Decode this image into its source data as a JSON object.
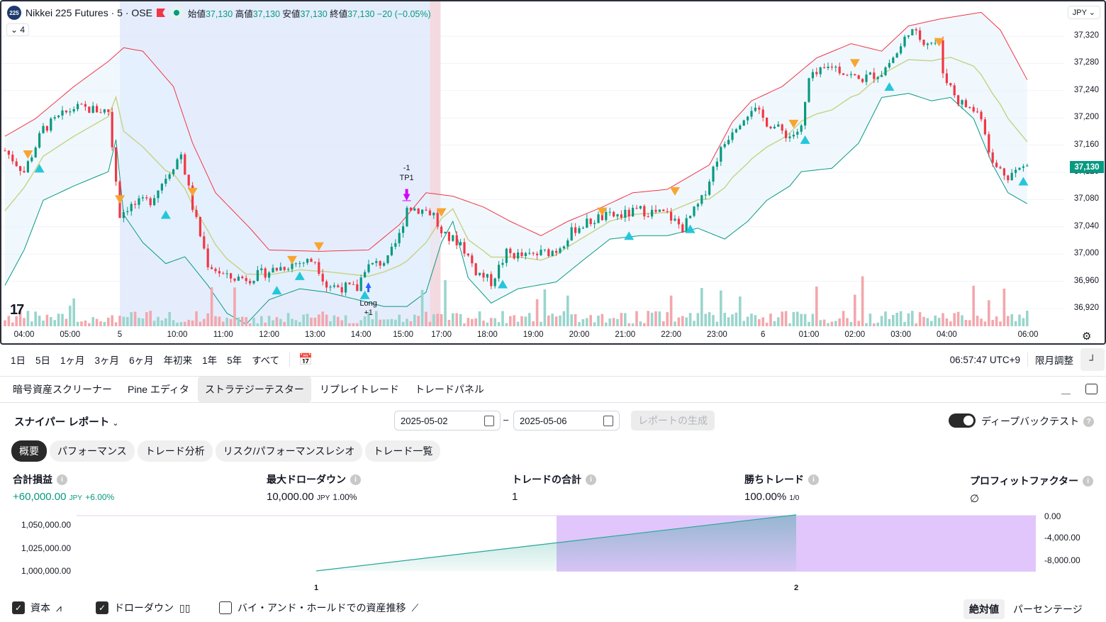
{
  "header": {
    "symbol_badge": "225",
    "title": "Nikkei 225 Futures · 5 · OSE",
    "open_label": "始値",
    "open": "37,130",
    "high_label": "高値",
    "high": "37,130",
    "low_label": "安値",
    "low": "37,130",
    "close_label": "終値",
    "close": "37,130",
    "change": "−20 (−0.05%)",
    "collapse_count": "4",
    "currency": "JPY"
  },
  "price_axis": [
    "37,320",
    "37,280",
    "37,240",
    "37,200",
    "37,160",
    "37,120",
    "37,080",
    "37,040",
    "37,000",
    "36,960",
    "36,920"
  ],
  "current_price": "37,130",
  "time_axis": [
    [
      "04:00",
      5
    ],
    [
      "05:00",
      17
    ],
    [
      "5",
      30
    ],
    [
      "10:00",
      45
    ],
    [
      "11:00",
      57
    ],
    [
      "12:00",
      69
    ],
    [
      "13:00",
      81
    ],
    [
      "14:00",
      93
    ],
    [
      "15:00",
      104
    ],
    [
      "17:00",
      114
    ],
    [
      "18:00",
      126
    ],
    [
      "19:00",
      138
    ],
    [
      "20:00",
      150
    ],
    [
      "21:00",
      162
    ],
    [
      "22:00",
      174
    ],
    [
      "23:00",
      186
    ],
    [
      "6",
      198
    ],
    [
      "01:00",
      210
    ],
    [
      "02:00",
      222
    ],
    [
      "03:00",
      234
    ],
    [
      "04:00",
      246
    ],
    [
      "06:00",
      267
    ]
  ],
  "chart_data": {
    "type": "candlestick",
    "bars": 268,
    "ylim": [
      36900,
      37340
    ],
    "close_path": [
      [
        0,
        37152
      ],
      [
        5,
        37121
      ],
      [
        10,
        37184
      ],
      [
        18,
        37215
      ],
      [
        27,
        37210
      ],
      [
        30,
        37058
      ],
      [
        32,
        37069
      ],
      [
        38,
        37079
      ],
      [
        44,
        37131
      ],
      [
        46,
        37147
      ],
      [
        49,
        37069
      ],
      [
        53,
        36986
      ],
      [
        58,
        36965
      ],
      [
        64,
        36965
      ],
      [
        69,
        36975
      ],
      [
        75,
        36986
      ],
      [
        81,
        36991
      ],
      [
        84,
        36954
      ],
      [
        92,
        36949
      ],
      [
        94,
        36980
      ],
      [
        100,
        36991
      ],
      [
        103,
        37027
      ],
      [
        105,
        37069
      ],
      [
        110,
        37064
      ],
      [
        112,
        37058
      ],
      [
        114,
        37027
      ],
      [
        119,
        37017
      ],
      [
        123,
        36975
      ],
      [
        127,
        36959
      ],
      [
        131,
        37001
      ],
      [
        136,
        36996
      ],
      [
        144,
        37006
      ],
      [
        149,
        37038
      ],
      [
        155,
        37053
      ],
      [
        162,
        37058
      ],
      [
        166,
        37064
      ],
      [
        173,
        37058
      ],
      [
        177,
        37038
      ],
      [
        182,
        37079
      ],
      [
        186,
        37142
      ],
      [
        190,
        37184
      ],
      [
        195,
        37215
      ],
      [
        199,
        37194
      ],
      [
        205,
        37173
      ],
      [
        208,
        37184
      ],
      [
        210,
        37256
      ],
      [
        216,
        37277
      ],
      [
        223,
        37256
      ],
      [
        229,
        37267
      ],
      [
        234,
        37303
      ],
      [
        236,
        37329
      ],
      [
        240,
        37314
      ],
      [
        244,
        37309
      ],
      [
        245,
        37267
      ],
      [
        249,
        37225
      ],
      [
        255,
        37204
      ],
      [
        258,
        37131
      ],
      [
        262,
        37116
      ],
      [
        267,
        37130
      ]
    ],
    "upper_band": [
      [
        0,
        37173
      ],
      [
        8,
        37199
      ],
      [
        18,
        37246
      ],
      [
        27,
        37283
      ],
      [
        31,
        37303
      ],
      [
        36,
        37298
      ],
      [
        44,
        37246
      ],
      [
        49,
        37163
      ],
      [
        55,
        37090
      ],
      [
        64,
        37038
      ],
      [
        69,
        37006
      ],
      [
        82,
        37004
      ],
      [
        95,
        37006
      ],
      [
        103,
        37043
      ],
      [
        110,
        37090
      ],
      [
        117,
        37085
      ],
      [
        125,
        37069
      ],
      [
        132,
        37048
      ],
      [
        140,
        37027
      ],
      [
        147,
        37048
      ],
      [
        156,
        37069
      ],
      [
        164,
        37090
      ],
      [
        173,
        37095
      ],
      [
        184,
        37131
      ],
      [
        190,
        37194
      ],
      [
        195,
        37225
      ],
      [
        203,
        37246
      ],
      [
        212,
        37288
      ],
      [
        221,
        37309
      ],
      [
        229,
        37298
      ],
      [
        236,
        37335
      ],
      [
        244,
        37345
      ],
      [
        255,
        37355
      ],
      [
        260,
        37329
      ],
      [
        267,
        37256
      ]
    ],
    "lower_band": [
      [
        0,
        36954
      ],
      [
        5,
        37006
      ],
      [
        10,
        37079
      ],
      [
        18,
        37100
      ],
      [
        27,
        37121
      ],
      [
        29,
        37168
      ],
      [
        31,
        37058
      ],
      [
        36,
        37017
      ],
      [
        42,
        36986
      ],
      [
        47,
        36996
      ],
      [
        53,
        36954
      ],
      [
        58,
        36913
      ],
      [
        63,
        36897
      ],
      [
        69,
        36933
      ],
      [
        77,
        36949
      ],
      [
        84,
        36944
      ],
      [
        92,
        36933
      ],
      [
        99,
        36923
      ],
      [
        105,
        36923
      ],
      [
        110,
        36944
      ],
      [
        114,
        37017
      ],
      [
        117,
        37048
      ],
      [
        121,
        36965
      ],
      [
        127,
        36928
      ],
      [
        134,
        36949
      ],
      [
        144,
        36959
      ],
      [
        151,
        36991
      ],
      [
        158,
        37022
      ],
      [
        166,
        37027
      ],
      [
        173,
        37027
      ],
      [
        181,
        37038
      ],
      [
        188,
        37022
      ],
      [
        194,
        37048
      ],
      [
        199,
        37079
      ],
      [
        205,
        37100
      ],
      [
        208,
        37121
      ],
      [
        216,
        37126
      ],
      [
        223,
        37163
      ],
      [
        229,
        37230
      ],
      [
        236,
        37236
      ],
      [
        242,
        37225
      ],
      [
        247,
        37230
      ],
      [
        253,
        37199
      ],
      [
        258,
        37131
      ],
      [
        262,
        37090
      ],
      [
        267,
        37074
      ]
    ],
    "sell_signals": [
      [
        6,
        37146
      ],
      [
        30,
        37080
      ],
      [
        49,
        37091
      ],
      [
        75,
        36991
      ],
      [
        82,
        37011
      ],
      [
        114,
        37061
      ],
      [
        156,
        37062
      ],
      [
        175,
        37092
      ],
      [
        206,
        37191
      ],
      [
        222,
        37280
      ],
      [
        244,
        37311
      ]
    ],
    "buy_signals": [
      [
        9,
        37126
      ],
      [
        42,
        37058
      ],
      [
        71,
        36947
      ],
      [
        77,
        36968
      ],
      [
        94,
        36940
      ],
      [
        130,
        36956
      ],
      [
        163,
        37027
      ],
      [
        179,
        37037
      ],
      [
        209,
        37168
      ],
      [
        231,
        37246
      ],
      [
        266,
        37107
      ]
    ],
    "backtest_range_bars": [
      30,
      111
    ],
    "entry": {
      "bar": 94,
      "label": "Long",
      "qty": "+1"
    },
    "exit": {
      "bar": 104,
      "label": "TP1",
      "qty": "-1"
    },
    "colors": {
      "up": "#089981",
      "down": "#f23645",
      "upper": "#f23645",
      "lower": "#089981",
      "basis": "#c9d38a"
    }
  },
  "bottom_bar": {
    "ranges": [
      "1日",
      "5日",
      "1ヶ月",
      "3ヶ月",
      "6ヶ月",
      "年初来",
      "1年",
      "5年",
      "すべて"
    ],
    "clock": "06:57:47 UTC+9",
    "adjust": "限月調整"
  },
  "panel": {
    "tabs": [
      "暗号資産スクリーナー",
      "Pine エディタ",
      "ストラテジーテスター",
      "リプレイトレード",
      "トレードパネル"
    ],
    "active_tab": 2,
    "report": "スナイパー レポート",
    "date_from": "2025-05-02",
    "date_to": "2025-05-06",
    "generate": "レポートの生成",
    "deep_backtest": "ディープバックテスト",
    "deep_backtest_on": true,
    "subtabs": [
      "概要",
      "パフォーマンス",
      "トレード分析",
      "リスク/パフォーマンスレシオ",
      "トレード一覧"
    ],
    "metrics": [
      {
        "title": "合計損益",
        "value": "+60,000.00",
        "unit": "JPY",
        "extra": "+6.00%"
      },
      {
        "title": "最大ドローダウン",
        "value": "10,000.00",
        "unit": "JPY",
        "extra": "1.00%"
      },
      {
        "title": "トレードの合計",
        "value": "1",
        "unit": "",
        "extra": ""
      },
      {
        "title": "勝ちトレード",
        "value": "100.00%",
        "unit": "",
        "extra": "1/0"
      },
      {
        "title": "プロフィットファクター",
        "value": "∅",
        "unit": "",
        "extra": ""
      }
    ],
    "legend": [
      "資本",
      "ドローダウン",
      "バイ・アンド・ホールドでの資産推移"
    ],
    "mode": [
      "絶対値",
      "パーセンテージ"
    ]
  },
  "equity_chart": {
    "type": "line",
    "x": [
      1,
      2
    ],
    "equity": [
      1000000,
      1060000
    ],
    "drawdown": [
      null,
      -10000
    ],
    "left_ticks": [
      "1,050,000.00",
      "1,025,000.00",
      "1,000,000.00"
    ],
    "right_ticks": [
      "0.00",
      "-4,000.00",
      "-8,000.00"
    ],
    "x_ticks": [
      "1",
      "2"
    ]
  }
}
